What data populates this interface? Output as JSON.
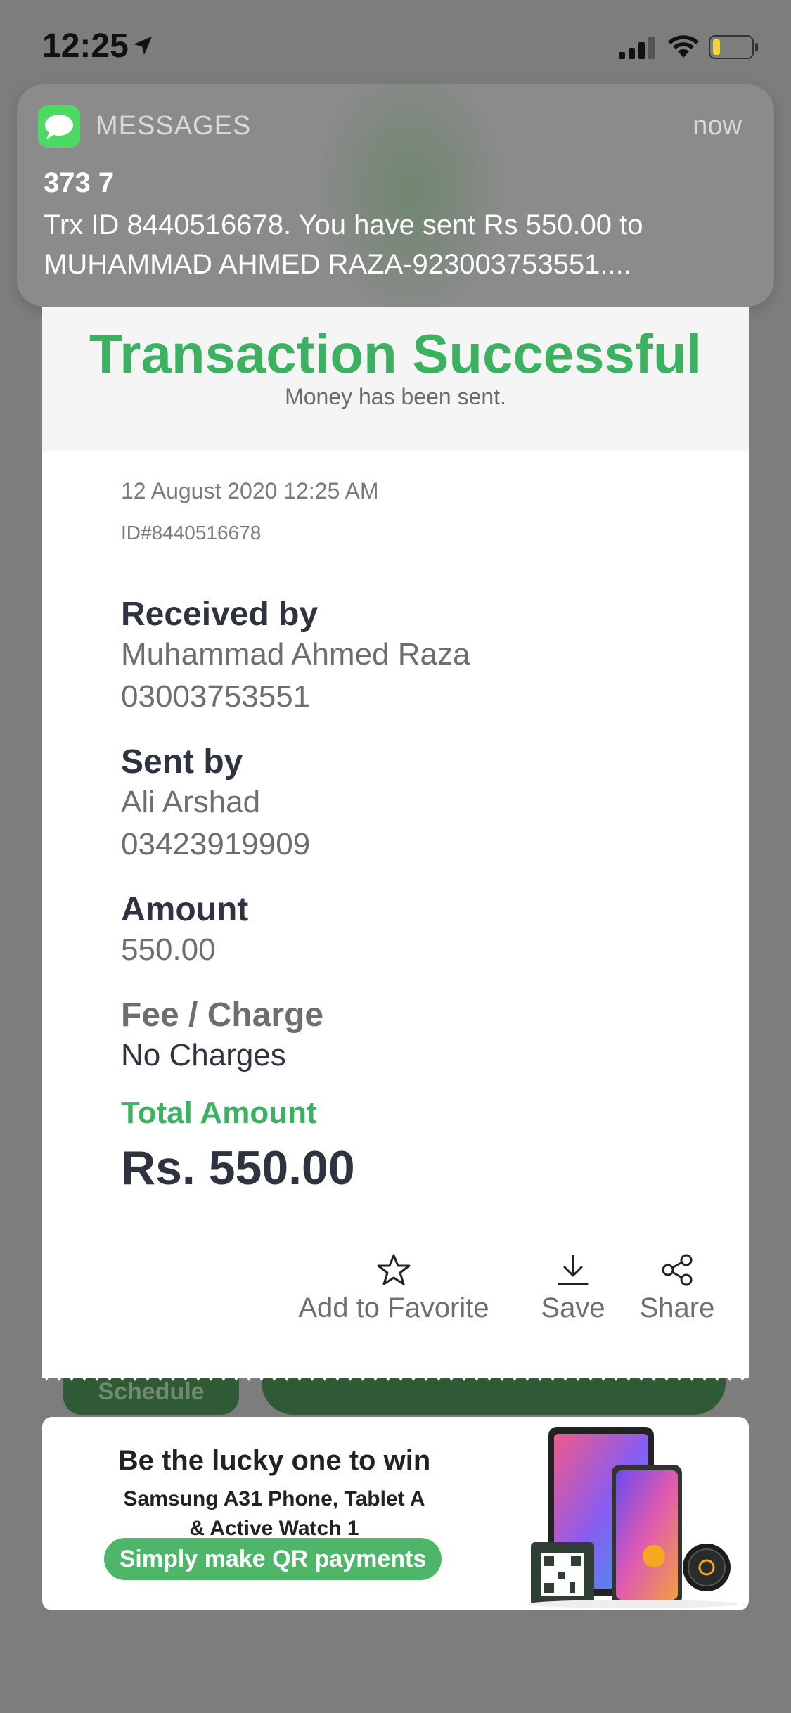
{
  "status_bar": {
    "time": "12:25"
  },
  "notification": {
    "app_name": "MESSAGES",
    "time": "now",
    "sender": "373 7",
    "body_line1": "Trx ID 8440516678. You have sent Rs 550.00 to",
    "body_line2": "MUHAMMAD AHMED RAZA-923003753551...."
  },
  "receipt": {
    "title": "Transaction Successful",
    "subtitle": "Money has been sent.",
    "date": "12 August 2020 12:25 AM",
    "id": "ID#8440516678",
    "received_by": {
      "label": "Received by",
      "name": "Muhammad Ahmed Raza",
      "number": "03003753551"
    },
    "sent_by": {
      "label": "Sent by",
      "name": "Ali Arshad",
      "number": "03423919909"
    },
    "amount": {
      "label": "Amount",
      "value": "550.00"
    },
    "fee": {
      "label": "Fee / Charge",
      "value": "No Charges"
    },
    "total": {
      "label": "Total Amount",
      "value": "Rs. 550.00"
    },
    "actions": {
      "favorite": "Add to Favorite",
      "save": "Save",
      "share": "Share"
    }
  },
  "background": {
    "schedule_label": "Schedule"
  },
  "banner": {
    "headline": "Be the lucky one to win",
    "line2": "Samsung A31 Phone, Tablet A",
    "line3": "& Active Watch 1",
    "cta": "Simply make QR payments"
  },
  "colors": {
    "accent_green": "#3cb162",
    "dark_green": "#2f5a35",
    "text_dark": "#2f3340"
  }
}
